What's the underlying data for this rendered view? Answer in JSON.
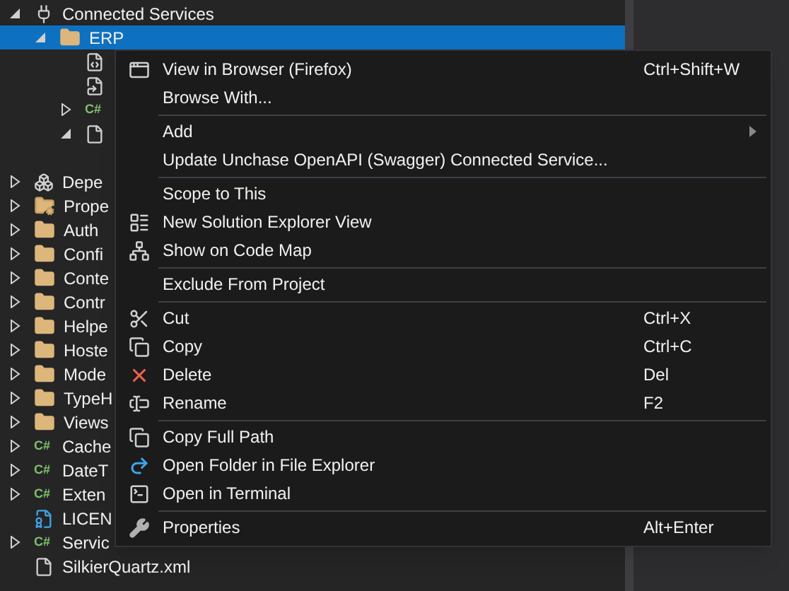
{
  "tree": {
    "items": [
      {
        "label": "Connected Services",
        "kind": "plug",
        "expanded": true,
        "selected": false,
        "children": [
          {
            "label": "ERP",
            "kind": "folder",
            "expanded": true,
            "selected": true,
            "children": [
              {
                "kind": "service-file"
              },
              {
                "kind": "doc-link"
              },
              {
                "kind": "csharp",
                "badge": "C#",
                "expanded": false
              },
              {
                "kind": "file",
                "expanded": true
              }
            ]
          }
        ]
      },
      {
        "label": "Depe",
        "kind": "deps",
        "expanded": false,
        "selected": false
      },
      {
        "label": "Prope",
        "kind": "folder-wrench",
        "expanded": false,
        "selected": false
      },
      {
        "label": "Auth",
        "kind": "folder",
        "expanded": false,
        "selected": false
      },
      {
        "label": "Confi",
        "kind": "folder",
        "expanded": false,
        "selected": false
      },
      {
        "label": "Conte",
        "kind": "folder",
        "expanded": false,
        "selected": false
      },
      {
        "label": "Contr",
        "kind": "folder",
        "expanded": false,
        "selected": false
      },
      {
        "label": "Helpe",
        "kind": "folder",
        "expanded": false,
        "selected": false
      },
      {
        "label": "Hoste",
        "kind": "folder",
        "expanded": false,
        "selected": false
      },
      {
        "label": "Mode",
        "kind": "folder",
        "expanded": false,
        "selected": false
      },
      {
        "label": "TypeH",
        "kind": "folder",
        "expanded": false,
        "selected": false
      },
      {
        "label": "Views",
        "kind": "folder",
        "expanded": false,
        "selected": false
      },
      {
        "label": "Cache",
        "kind": "csharp",
        "badge": "C#",
        "expanded": false,
        "selected": false
      },
      {
        "label": "DateT",
        "kind": "csharp",
        "badge": "C#",
        "expanded": false,
        "selected": false
      },
      {
        "label": "Exten",
        "kind": "csharp",
        "badge": "C#",
        "expanded": false,
        "selected": false
      },
      {
        "label": "LICEN",
        "kind": "license",
        "selected": false
      },
      {
        "label": "Servic",
        "kind": "csharp",
        "badge": "C#",
        "expanded": false,
        "selected": false
      },
      {
        "label": "SilkierQuartz.xml",
        "kind": "file",
        "selected": false
      }
    ]
  },
  "context_menu": {
    "groups": [
      [
        {
          "label": "View in Browser (Firefox)",
          "kind": "browser",
          "shortcut": "Ctrl+Shift+W"
        },
        {
          "label": "Browse With..."
        }
      ],
      [
        {
          "label": "Add",
          "submenu": true
        },
        {
          "label": "Update Unchase OpenAPI (Swagger) Connected Service..."
        }
      ],
      [
        {
          "label": "Scope to This"
        },
        {
          "label": "New Solution Explorer View",
          "kind": "list-window"
        },
        {
          "label": "Show on Code Map",
          "kind": "code-map"
        }
      ],
      [
        {
          "label": "Exclude From Project"
        }
      ],
      [
        {
          "label": "Cut",
          "kind": "cut",
          "shortcut": "Ctrl+X"
        },
        {
          "label": "Copy",
          "kind": "copy",
          "shortcut": "Ctrl+C"
        },
        {
          "label": "Delete",
          "kind": "delete",
          "shortcut": "Del"
        },
        {
          "label": "Rename",
          "kind": "rename",
          "shortcut": "F2"
        }
      ],
      [
        {
          "label": "Copy Full Path",
          "kind": "copy"
        },
        {
          "label": "Open Folder in File Explorer",
          "kind": "open-folder"
        },
        {
          "label": "Open in Terminal",
          "kind": "terminal"
        }
      ],
      [
        {
          "label": "Properties",
          "kind": "wrench",
          "shortcut": "Alt+Enter"
        }
      ]
    ]
  }
}
